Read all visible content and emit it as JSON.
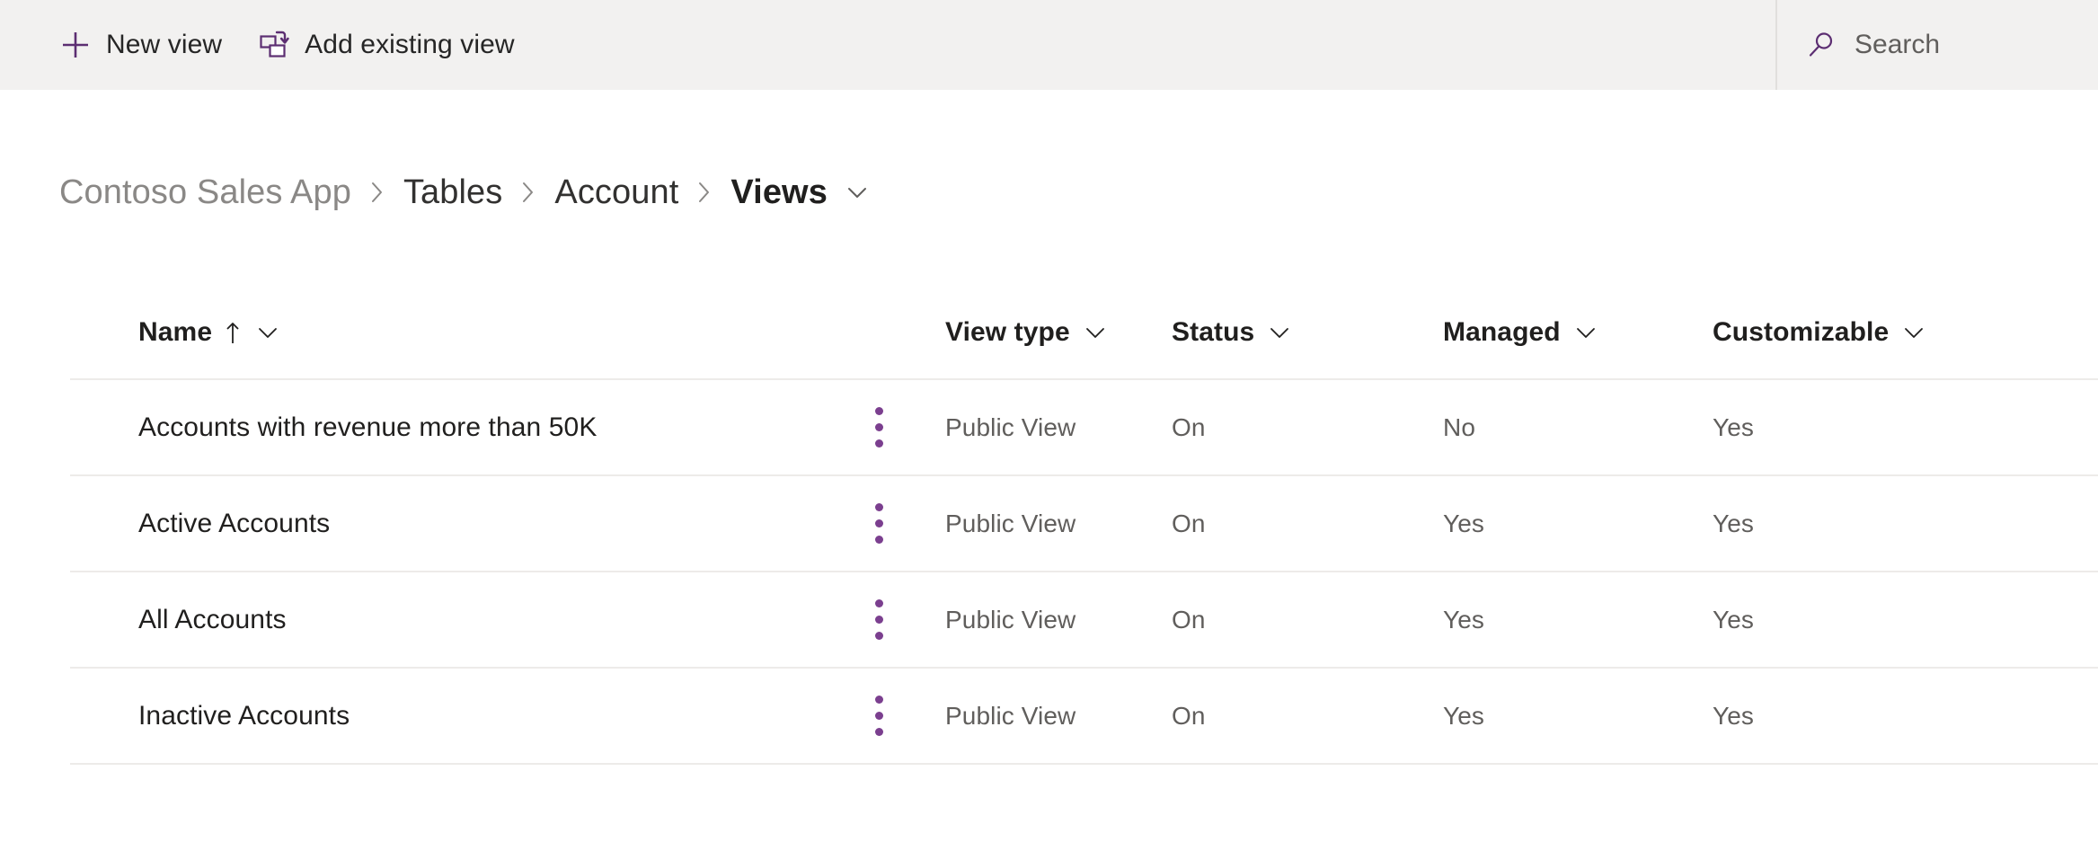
{
  "colors": {
    "accent_purple": "#5c2e72",
    "dots_purple": "#7b3f8f",
    "commandbar_bg": "#f2f1f0",
    "divider": "#edebe9",
    "text_primary": "#201f1e",
    "text_secondary": "#605e5c",
    "text_muted": "#8a8886"
  },
  "commandbar": {
    "new_view": {
      "label": "New view",
      "icon": "plus-icon"
    },
    "add_existing_view": {
      "label": "Add existing view",
      "icon": "add-existing-view-icon"
    },
    "search": {
      "placeholder": "Search",
      "value": "",
      "icon": "search-icon"
    }
  },
  "breadcrumb": {
    "items": [
      {
        "label": "Contoso Sales App",
        "state": "muted"
      },
      {
        "label": "Tables",
        "state": "normal"
      },
      {
        "label": "Account",
        "state": "normal"
      },
      {
        "label": "Views",
        "state": "current"
      }
    ],
    "separator": "›",
    "dropdown_icon": "chevron-down-icon"
  },
  "grid": {
    "columns": [
      {
        "key": "name",
        "label": "Name",
        "sorted": true,
        "sort_direction": "ascending",
        "sort_icon": "arrow-up-icon",
        "menu_icon": "chevron-down-icon"
      },
      {
        "key": "view_type",
        "label": "View type",
        "menu_icon": "chevron-down-icon"
      },
      {
        "key": "status",
        "label": "Status",
        "menu_icon": "chevron-down-icon"
      },
      {
        "key": "managed",
        "label": "Managed",
        "menu_icon": "chevron-down-icon"
      },
      {
        "key": "customizable",
        "label": "Customizable",
        "menu_icon": "chevron-down-icon"
      }
    ],
    "row_menu_icon": "more-vertical-icon",
    "rows": [
      {
        "name": "Accounts with revenue more than 50K",
        "view_type": "Public View",
        "status": "On",
        "managed": "No",
        "customizable": "Yes"
      },
      {
        "name": "Active Accounts",
        "view_type": "Public View",
        "status": "On",
        "managed": "Yes",
        "customizable": "Yes"
      },
      {
        "name": "All Accounts",
        "view_type": "Public View",
        "status": "On",
        "managed": "Yes",
        "customizable": "Yes"
      },
      {
        "name": "Inactive Accounts",
        "view_type": "Public View",
        "status": "On",
        "managed": "Yes",
        "customizable": "Yes"
      }
    ]
  }
}
